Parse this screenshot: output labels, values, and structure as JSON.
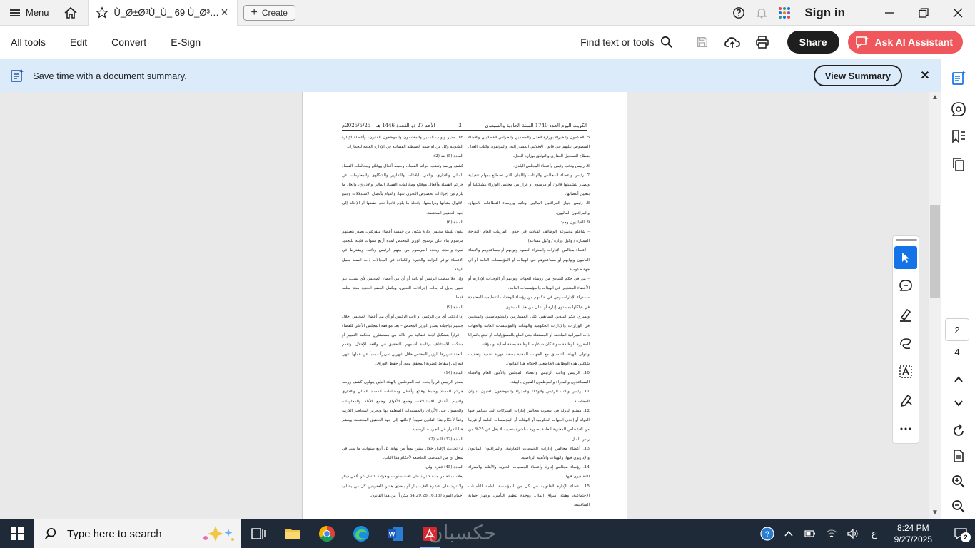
{
  "tabbar": {
    "menu_label": "Menu",
    "tab_title": "Ù_Ø±Ø³Ù_Ù_ 69 Ù_Ø³…",
    "tab_close": "×",
    "create_label": "Create",
    "sign_in": "Sign in"
  },
  "toolbar": {
    "items": [
      "All tools",
      "Edit",
      "Convert",
      "E-Sign"
    ],
    "find_label": "Find text or tools",
    "share_label": "Share",
    "ai_label": "Ask AI Assistant"
  },
  "banner": {
    "text": "Save time with a document summary.",
    "button": "View Summary",
    "close": "✕"
  },
  "document": {
    "header_right": "الكويت اليوم العدد 1740 السنة الحادية والسبعون",
    "header_page": "3",
    "header_left": "الأحد 27 ذو القعدة 1446 هـ – 2025/5/25م",
    "right_column": [
      "5. الحكمون والخبراء بوزارة العدل والمصفين والحراس القضائيين والأمناء المنصوص عليهم في قانون الإفلاس المشار إليه، والموثقون وكتاب العدل بقطاع التسجيل العقاري والتوثيق بوزارة العدل.",
      "6. رئيس ونائب رئيس وأعضاء المجلس البلدي.",
      "7. رئيس وأعضاء المجالس والهيئات واللجان التي تضطلع بمهام تنفيذية ويصدر بتشكيلها قانون أو مرسوم أو قرار من مجلس الوزراء بتشكيلها أو بتعيين أعضائها.",
      "8. رئيس جهاز المراقبين الماليين ونائبه ورؤساء القطاعات بالجهاز، والمراقبون الماليون.",
      "9. القياديون وهم:",
      "– شاغلو مجموعة الوظائف القيادية في جدول المرتبات العام (الدرجة الممتازة / وكيل وزارة / وكيل مساعد).",
      "– أعضاء مجالس الإدارات والمدراء العموم ونوابهم أو مساعدوهم والأمناء العامون ونوابهم أو مساعدوهم في الهيئات أو المؤسسات العامة أو أي جهة حكومية.",
      "– من في حكم القيادي من رؤساء الجهات ونوابهم أو الوحدات الإدارية أو الأعضاء المنتدبين في الهيئات والمؤسسات العامة.",
      "– مدراء الإدارات ومن في حكمهم من رؤساء الوحدات التنظيمية المعتمدة في هياكلها بمستوى إدارة أو أعلى من هذا المستوى.",
      "ويسري حكم البندين السابقين على العسكريين والدبلوماسيين والمدنيين في الوزارات والإدارات الحكومية والهيئات والمؤسسات العامة والجهات ذات الميزانية الملحقة أو المستقلة متى اطلع بالمسؤوليات أو تمتع بالمزايا المقررة للوظيفة سواء كان شاغلهم الوظيفة بصفة أصلية أو مؤقتة.",
      "وتتولى الهيئة بالتنسيق مع الجهات المعنية بصفة دورية تحديد وتحديث شاغلي هذه الوظائف الخاضعين لأحكام هذا القانون.",
      "10. الرئيس ونائب الرئيس وأعضاء المجلس والأمين العام والأمناء المساعدون والمدراء والموظفون الفنيون بالهيئة.",
      "11. رئيس ونائب الرئيس والوكلاء والمدراء والموظفون الفنيون بديوان المحاسبة.",
      "12. ممثلو الدولة في عضوية مجالس إدارات الشركات التي تساهم فيها الدولة أو إحدى الجهات الحكومية أو الهيئات أو المؤسسات العامة أو غيرها من الأشخاص المعنوية العامة بصورة مباشرة بنصيب لا يقل عن 25% من رأس المال.",
      "13. أعضاء مجالس إدارات الجمعيات التعاونية، والمراقبون الماليون والإداريون فيها، والهيئات والأندية الرياضية.",
      "14. رؤساء مجالس إدارة وأعضاء الجمعيات الخيرية والأهلية والمدراء التنفيذيون فيها.",
      "15. أعضاء الإدارة القانونية في كل من المؤسسة العامة للتأمينات الاجتماعية، وهيئة أسواق المال، ووحدة تنظيم التأمين، وجهاز حماية المنافسة."
    ],
    "left_column": [
      "16. مدير ونواب المدير والمفتشون والموظفون الفنيون، وأعضاء الإدارة القانونية وكل من له صفة الضبطية القضائية في الإدارة العامة للجمارك.",
      "المادة (5) بند (2):",
      "كشف ورصد وتعقب جرائم الفساد، وضبط أفعال ووقائع ومخالفات الفساد المالي والإداري، وتلقي البلاغات والتقارير والشكاوى والمعلومات عن جرائم الفساد وأفعال ووقائع ومخالفات الفساد المالي والإداري، واتخاذ ما يلزم من إجراءات بخصوص التحري عنها، والقيام بأعمال الاستدلالات وجمع الأقوال بشأنها ودراستها، واتخاذ ما يلزم قانوناً نحو حفظها أو الإحالة إلى جهة التحقيق المختصة.",
      "المادة (6)",
      "يكون للهيئة مجلس إدارة يتكون من خمسة أعضاء متفرغين، يصدر بتعيينهم مرسوم بناء على ترشيح الوزير المختص لمدة أربع سنوات قابلة للتجديد لمرة واحدة، ويحدد المرسوم من بينهم الرئيس ونائبه. ويشترط في الأعضاء توافر النزاهة والخبرة والكفاءة في المجالات ذات الصلة بعمل الهيئة.",
      "وإذا خلا منصب الرئيس أو نائبه أو أي من أعضاء المجلس لأي سبب، يتم تعيين بديل له بذات إجراءات التعيين، ويكمل العضو الجديد مدة سلفه فقط.",
      "المادة (9)",
      "إذا ارتكب أي من الرئيس أو نائب الرئيس أو أي من أعضاء المجلس إخلال جسيم بواجباته يصدر الوزير المختص – بعد موافقة المجلس الأعلى للقضاء – قراراً بتشكيل لجنة قضائية من ثلاثة من مستشاري محكمة التمييز أو محكمة الاستئناف برئاسة أقدمهم، للتحقيق في واقعة الإخلال. وتقدم اللجنة تقريرها للوزير المختص خلال شهرين تقريراً مسبباً عن عملها تنتهي فيه إلى إسقاط عضوية المحقق معه، أو حفظ الأوراق.",
      "المادة (14)",
      "يصدر الرئيس قراراً يحدد فيه الموظفين بالهيئة الذين يتولون كشف ورصد جرائم الفساد وضبط وقائع وأفعال ومخالفات الفساد المالي والإداري والقيام بأعمال الاستدلالات وجمع الأقوال وجمع الأدلة والمعلومات والحصول على الأوراق والمستندات المتعلقة بها وتحرير المحاضر اللازمة وفقاً لأحكام هذا القانون تمهيداً لإحالتها إلى جهة التحقيق المختصة، وينشر هذا القرار في الجريدة الرسمية.",
      "المادة (32) البند (2):",
      "2) تحديث الإقرار خلال ستين يوماً من نهاية كل أربع سنوات، ما بقي في شغل أي من المناصب الخاضعة لأحكام هذا الباب.",
      "المادة (45) فقرة أولى:",
      "يعاقب بالحبس مدة لا تزيد على ثلاث سنوات وبغرامة لا تقل عن ألفي دينار ولا تزيد على عشرة آلاف دينار أو بإحدى هاتين العقوبتين كل من يخالف أحكام المواد (34,29,26,16,15 مكرراً) من هذا القانون."
    ]
  },
  "page_nav": {
    "current": "2",
    "total": "4"
  },
  "taskbar": {
    "search_placeholder": "Type here to search",
    "watermark": "حكسبان",
    "lang": "ع",
    "time": "8:24 PM",
    "date": "9/27/2025",
    "notif_count": "2"
  },
  "colors": {
    "accent": "#1473e6",
    "ai_button": "#f0575c",
    "banner_bg": "#dbebfa",
    "taskbar_bg": "#1f2a38"
  }
}
